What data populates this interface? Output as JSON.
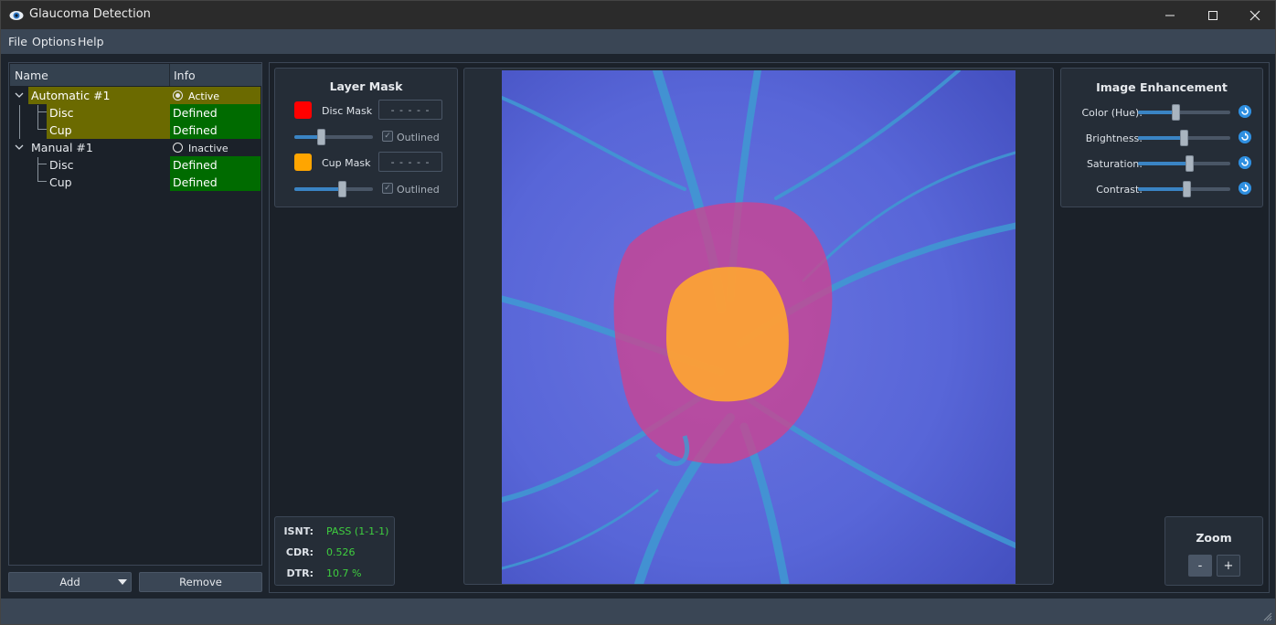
{
  "window": {
    "title": "Glaucoma Detection",
    "icon": "eye-icon",
    "minimize": "—",
    "maximize": "☐",
    "close": "✕"
  },
  "menu": [
    "File",
    "Options",
    "Help"
  ],
  "tree": {
    "headers": {
      "name": "Name",
      "info": "Info"
    },
    "rows": [
      {
        "name": "Automatic #1",
        "info": "Active"
      },
      {
        "name": "Disc",
        "info": "Defined"
      },
      {
        "name": "Cup",
        "info": "Defined"
      },
      {
        "name": "Manual #1",
        "info": "Inactive"
      },
      {
        "name": "Disc",
        "info": "Defined"
      },
      {
        "name": "Cup",
        "info": "Defined"
      }
    ]
  },
  "buttons": {
    "add": "Add",
    "remove": "Remove"
  },
  "layer_mask": {
    "title": "Layer Mask",
    "disc": {
      "label": "Disc Mask",
      "value": "- - - - -",
      "color": "#ff0000",
      "opacity": 0.33,
      "outlined_label": "Outlined",
      "outlined": true
    },
    "cup": {
      "label": "Cup Mask",
      "value": "- - - - -",
      "color": "#ffa500",
      "opacity": 0.62,
      "outlined_label": "Outlined",
      "outlined": true
    }
  },
  "stats": {
    "isnt": {
      "label": "ISNT:",
      "value": "PASS (1-1-1)"
    },
    "cdr": {
      "label": "CDR:",
      "value": "0.526"
    },
    "dtr": {
      "label": "DTR:",
      "value": "10.7 %"
    }
  },
  "enhancement": {
    "title": "Image Enhancement",
    "sliders": [
      {
        "label": "Color (Hue):",
        "value": 0.4
      },
      {
        "label": "Brightness:",
        "value": 0.5
      },
      {
        "label": "Saturation:",
        "value": 0.56
      },
      {
        "label": "Contrast:",
        "value": 0.53
      }
    ],
    "reset_icon": "reset-icon"
  },
  "zoom": {
    "title": "Zoom",
    "minus": "-",
    "plus": "+"
  },
  "colors": {
    "accent": "#3a84c4",
    "active_row": "#6b6a00",
    "defined": "#006b00",
    "pass": "#3fcf3f"
  }
}
